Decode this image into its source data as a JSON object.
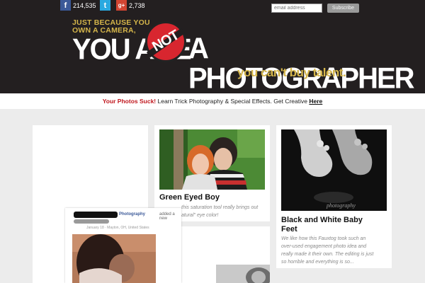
{
  "social": {
    "facebook": {
      "icon": "facebook-icon",
      "glyph": "f",
      "count": "214,535",
      "color": "#3b5998"
    },
    "twitter": {
      "icon": "twitter-icon",
      "glyph": "t",
      "color": "#2aa9e0"
    },
    "googleplus": {
      "icon": "google-plus-icon",
      "glyph": "g+",
      "count": "2,738",
      "color": "#d24532"
    }
  },
  "subscribe": {
    "placeholder": "email address",
    "button_label": "Subscribe"
  },
  "logo": {
    "line1": "JUST BECAUSE YOU",
    "line2": "OWN A CAMERA,",
    "main_left": "YOU ARE",
    "not": "NOT",
    "main_right": "A PHOTOGRAPHER",
    "tagline": "you can't buy talent."
  },
  "promo": {
    "red_text": "Your Photos Suck!",
    "text": " Learn Trick Photography & Special Effects. Get Creative ",
    "link": "Here"
  },
  "cards": {
    "green": {
      "title": "Green Eyed Boy",
      "excerpt_line1": "this saturation tool really brings out",
      "excerpt_line2": "atural\" eye color!"
    },
    "bw": {
      "title_line1": "Black and White Baby",
      "title_line2": "Feet",
      "excerpt_line1": "We like how this Fauxtog took such an",
      "excerpt_line2": "over-used engagement photo idea and",
      "excerpt_line3": "really made it their own. The editing is just",
      "excerpt_line4": "so horrible and everything is so...",
      "watermark": "photography"
    }
  },
  "fb_post": {
    "name": "Photography",
    "added": "added a new",
    "date": "January 18 · Mayton, OH, United States"
  },
  "colors": {
    "header_bg": "#231f20",
    "gold": "#d4b54a",
    "red": "#d8262f"
  }
}
